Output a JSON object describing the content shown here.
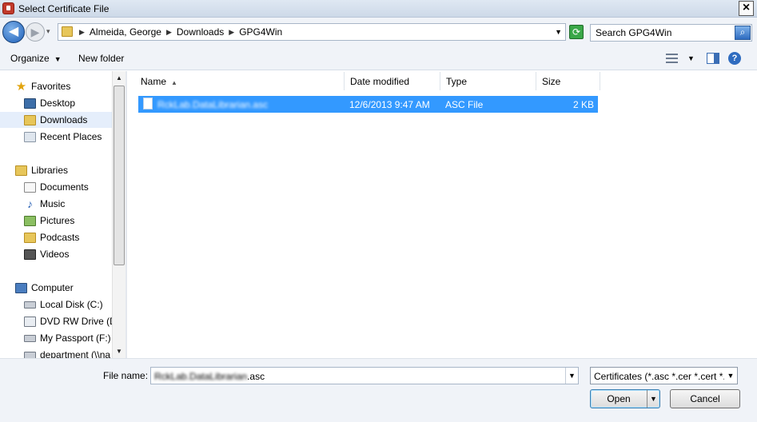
{
  "window": {
    "title": "Select Certificate File",
    "close_label": "×"
  },
  "nav": {
    "back_glyph": "◀",
    "forward_glyph": "▶",
    "history_glyph": "▾",
    "breadcrumbs": [
      "Almeida, George",
      "Downloads",
      "GPG4Win"
    ],
    "crumb_separator": "▶",
    "dropdown_glyph": "▼",
    "refresh_glyph": "⟳",
    "search_placeholder": "Search GPG4Win",
    "search_glyph": "⌕"
  },
  "toolbar": {
    "organize_label": "Organize",
    "new_folder_label": "New folder",
    "dropdown_glyph": "▼",
    "help_glyph": "?"
  },
  "sidebar": {
    "groups": [
      {
        "label": "Favorites",
        "icon": "star-icon"
      },
      {
        "label": "Libraries",
        "icon": "library-icon"
      },
      {
        "label": "Computer",
        "icon": "computer-icon"
      }
    ],
    "items": [
      {
        "label": "Desktop",
        "icon": "desktop-icon"
      },
      {
        "label": "Downloads",
        "icon": "downloads-folder-icon",
        "selected": true
      },
      {
        "label": "Recent Places",
        "icon": "recent-places-icon"
      },
      {
        "label": "Documents",
        "icon": "documents-icon"
      },
      {
        "label": "Music",
        "icon": "music-icon"
      },
      {
        "label": "Pictures",
        "icon": "pictures-icon"
      },
      {
        "label": "Podcasts",
        "icon": "podcasts-icon"
      },
      {
        "label": "Videos",
        "icon": "videos-icon"
      },
      {
        "label": "Local Disk (C:)",
        "icon": "local-disk-icon"
      },
      {
        "label": "DVD RW Drive (D",
        "icon": "dvd-drive-icon"
      },
      {
        "label": "My Passport (F:)",
        "icon": "usb-drive-icon"
      },
      {
        "label": "department (\\\\na",
        "icon": "network-drive-icon"
      }
    ],
    "scroll_up_glyph": "▲",
    "scroll_down_glyph": "▼"
  },
  "file_list": {
    "columns": [
      "Name",
      "Date modified",
      "Type",
      "Size"
    ],
    "sort_glyph": "▲",
    "rows": [
      {
        "name": "RckLab.DataLibrarian.asc",
        "date_modified": "12/6/2013 9:47 AM",
        "type": "ASC File",
        "size": "2 KB",
        "selected": true
      }
    ]
  },
  "footer": {
    "file_name_label": "File name:",
    "file_name_value_blurred": "RckLab.DataLibrarian",
    "file_name_value_ext": ".asc",
    "file_type_value": "Certificates (*.asc *.cer *.cert *.c",
    "dropdown_glyph": "▼",
    "open_label": "Open",
    "cancel_label": "Cancel"
  },
  "colors": {
    "selection": "#3399ff",
    "chrome": "#f0f3f8",
    "titlebar": "#dfe8f3"
  }
}
